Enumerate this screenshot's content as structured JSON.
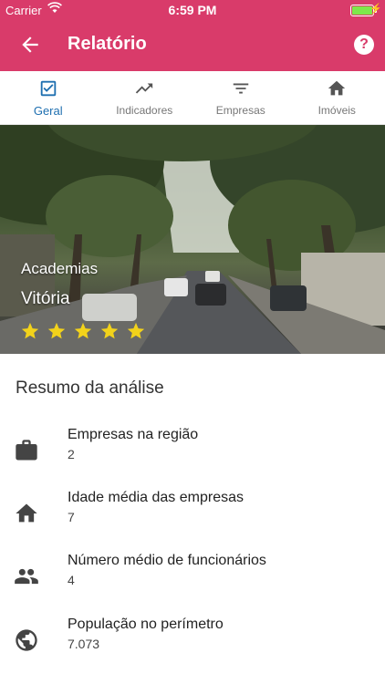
{
  "status_bar": {
    "carrier": "Carrier",
    "time": "6:59 PM"
  },
  "app_bar": {
    "title": "Relatório",
    "help": "?"
  },
  "tabs": [
    {
      "label": "Geral",
      "icon": "checkbox-icon",
      "active": true
    },
    {
      "label": "Indicadores",
      "icon": "trending-up-icon",
      "active": false
    },
    {
      "label": "Empresas",
      "icon": "filter-icon",
      "active": false
    },
    {
      "label": "Imóveis",
      "icon": "home-icon",
      "active": false
    }
  ],
  "hero": {
    "category": "Academias",
    "city": "Vitória",
    "rating": 5,
    "rating_max": 5
  },
  "summary": {
    "title": "Resumo da análise",
    "items": [
      {
        "icon": "briefcase-icon",
        "label": "Empresas na região",
        "value": "2"
      },
      {
        "icon": "home-icon",
        "label": "Idade média das empresas",
        "value": "7"
      },
      {
        "icon": "people-icon",
        "label": "Número médio de funcionários",
        "value": "4"
      },
      {
        "icon": "globe-icon",
        "label": "População no perímetro",
        "value": "7.073"
      }
    ]
  },
  "colors": {
    "brand": "#d93b6a",
    "accent": "#1e6fb0",
    "star": "#f2d21b"
  }
}
